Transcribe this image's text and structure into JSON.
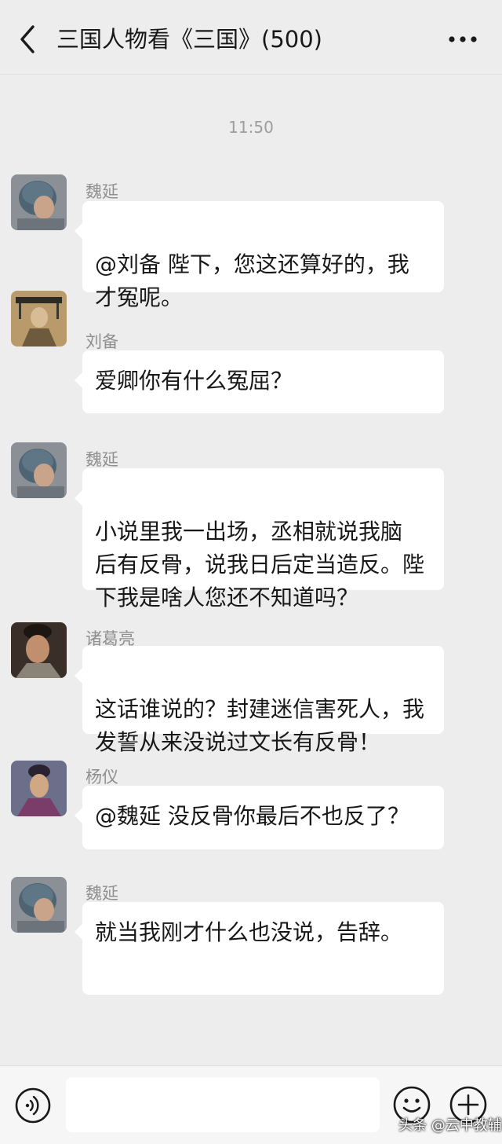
{
  "header": {
    "back_icon": "chevron-left-icon",
    "title": "三国人物看《三国》(500)",
    "more_icon": "ellipsis-icon"
  },
  "time_label": "11:50",
  "messages": [
    {
      "sender": "魏延",
      "text": "@刘备 陛下，您这还算好的，我才冤呢。",
      "lines": [
        "@刘备 陛下，您这还算好的，我",
        "才冤呢。"
      ]
    },
    {
      "sender": "刘备",
      "text": "爱卿你有什么冤屈？",
      "lines": [
        "爱卿你有什么冤屈？"
      ]
    },
    {
      "sender": "魏延",
      "text": "小说里我一出场，丞相就说我脑后有反骨，说我日后定当造反。陛下我是啥人您还不知道吗？",
      "lines": [
        "小说里我一出场，丞相就说我脑",
        "后有反骨，说我日后定当造反。陛",
        "下我是啥人您还不知道吗？"
      ]
    },
    {
      "sender": "诸葛亮",
      "text": "这话谁说的？封建迷信害死人，我发誓从来没说过文长有反骨！",
      "lines": [
        "这话谁说的？封建迷信害死人，我",
        "发誓从来没说过文长有反骨！"
      ]
    },
    {
      "sender": "杨仪",
      "text": "@魏延 没反骨你最后不也反了？",
      "lines": [
        "@魏延 没反骨你最后不也反了？"
      ]
    },
    {
      "sender": "魏延",
      "text": "就当我刚才什么也没说，告辞。",
      "lines": [
        "就当我刚才什么也没说，告辞。"
      ]
    }
  ],
  "bottom_bar": {
    "voice_icon": "voice-icon",
    "input_value": "",
    "emoji_icon": "emoji-icon",
    "plus_icon": "plus-icon"
  },
  "watermark": "头条 @云中教辅"
}
